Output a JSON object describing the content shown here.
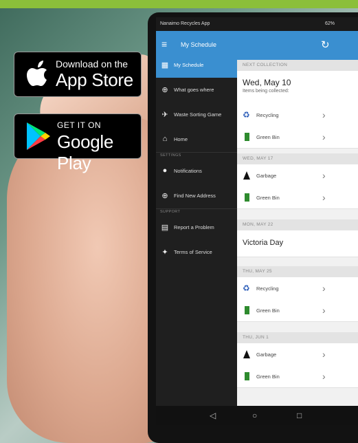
{
  "badges": {
    "apple": {
      "small": "Download on the",
      "big": "App Store"
    },
    "google": {
      "small": "GET IT ON",
      "big": "Google Play"
    }
  },
  "status": {
    "app_name": "Nanaimo Recycles App",
    "right": "62%"
  },
  "appbar": {
    "title": "My Schedule"
  },
  "drawer": {
    "items": [
      {
        "label": "My Schedule",
        "icon": "calendar-icon"
      },
      {
        "label": "What goes where",
        "icon": "search-icon"
      },
      {
        "label": "Waste Sorting Game",
        "icon": "gamepad-icon"
      },
      {
        "label": "Home",
        "icon": "home-icon"
      }
    ],
    "settings_header": "SETTINGS",
    "settings": [
      {
        "label": "Notifications",
        "icon": "bell-icon"
      },
      {
        "label": "Find New Address",
        "icon": "search-icon"
      }
    ],
    "support_header": "SUPPORT",
    "support": [
      {
        "label": "Report a Problem",
        "icon": "report-icon"
      },
      {
        "label": "Terms of Service",
        "icon": "handshake-icon"
      }
    ]
  },
  "schedule": {
    "next_header": "NEXT COLLECTION",
    "next_date": "Wed, May 10",
    "next_sub": "Items being collected:",
    "next_items": [
      "Recycling",
      "Green Bin"
    ],
    "groups": [
      {
        "header": "WED, MAY 17",
        "items": [
          "Garbage",
          "Green Bin"
        ]
      },
      {
        "header": "MON, MAY 22",
        "holiday": "Victoria Day"
      },
      {
        "header": "THU, MAY 25",
        "items": [
          "Recycling",
          "Green Bin"
        ]
      },
      {
        "header": "THU, JUN 1",
        "items": [
          "Garbage",
          "Green Bin"
        ]
      }
    ]
  },
  "colors": {
    "accent": "#3a8fd0",
    "recycling": "#2a5cb8",
    "green_bin": "#2e8b2e",
    "garbage": "#111111"
  },
  "navbar": {
    "back": "◁",
    "home": "○",
    "recent": "□"
  }
}
